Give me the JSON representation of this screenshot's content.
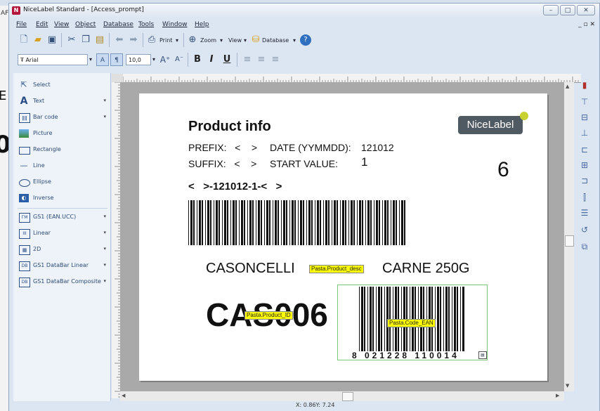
{
  "window": {
    "title": "NiceLabel Standard - [Access_prompt]",
    "icon_text": "N",
    "minimize": "–",
    "maximize": "□",
    "close": "✕"
  },
  "background": {
    "top_text": "AF",
    "left_glyph_1": "E",
    "left_glyph_2": "0"
  },
  "menu": {
    "items": [
      "File",
      "Edit",
      "View",
      "Object",
      "Database",
      "Tools",
      "Window",
      "Help"
    ],
    "mdi_controls": "_ ▫ ✕"
  },
  "toolbar": {
    "print_label": "Print",
    "zoom_label": "Zoom",
    "view_label": "View",
    "database_label": "Database",
    "font_name": "Arial",
    "font_size": "10,0",
    "bold": "B",
    "italic": "I",
    "underline": "U"
  },
  "toolbox": {
    "tools": [
      {
        "label": "Select",
        "icon": "cursor-icon"
      },
      {
        "label": "Text",
        "icon": "text-icon"
      },
      {
        "label": "Bar code",
        "icon": "barcode-icon"
      },
      {
        "label": "Picture",
        "icon": "picture-icon"
      },
      {
        "label": "Rectangle",
        "icon": "rectangle-icon"
      },
      {
        "label": "Line",
        "icon": "line-icon"
      },
      {
        "label": "Ellipse",
        "icon": "ellipse-icon"
      },
      {
        "label": "Inverse",
        "icon": "inverse-icon"
      }
    ],
    "barcodes": [
      {
        "label": "GS1 (EAN.UCC)",
        "badge": "ГМ"
      },
      {
        "label": "Linear",
        "badge": "ІІІ"
      },
      {
        "label": "2D",
        "badge": "▦"
      },
      {
        "label": "GS1 DataBar Linear",
        "badge": "DB"
      },
      {
        "label": "GS1 DataBar Composite",
        "badge": "DB"
      }
    ]
  },
  "label": {
    "heading": "Product info",
    "prefix_line": "PREFIX:   <    >",
    "date_label": "DATE (YYMMDD):",
    "date_value": "121012",
    "suffix_line": "SUFFIX:   <    >",
    "start_label": "START VALUE:",
    "start_value": "1",
    "counter": "6",
    "code_line": "<   >-121012-1-<   >",
    "product_desc": "CASONCELLI",
    "product_desc_suffix": "CARNE 250G",
    "product_code": "CAS006",
    "ean_digits": "8 021228 110014",
    "tags": {
      "desc": "Pasta.Product_desc",
      "id": "Pasta.Product_ID",
      "ean": "Pasta.Code_EAN"
    },
    "logo": "NiceLabel"
  },
  "status": {
    "coords": "X: 0.86Y: 7.24"
  },
  "colors": {
    "accent": "#1f6fc2",
    "logo_bg": "#505a63",
    "logo_dot": "#c7d12f",
    "tag_bg": "#ffff00"
  }
}
